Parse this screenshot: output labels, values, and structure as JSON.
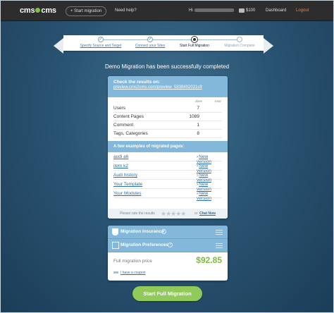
{
  "nav": {
    "logo_left": "cms",
    "logo_right": "cms",
    "start_migration": "+ Start migration",
    "need_help": "Need help?",
    "greeting": "Hi",
    "balance": "$100",
    "dashboard": "Dashboard",
    "logout": "Logout"
  },
  "steps": [
    {
      "label": "Specify Source and Target",
      "state": "done"
    },
    {
      "label": "Connect your Sites",
      "state": "done"
    },
    {
      "label": "Start Full Migration",
      "state": "current"
    },
    {
      "label": "Migration Complete",
      "state": "future"
    }
  ],
  "success_message": "Demo Migration has been successfully completed",
  "results": {
    "title": "Check the results on:",
    "url": "preview.cms2cms.com/preview_5838402021c9",
    "col_done": "done",
    "col_total": "total",
    "stats": [
      {
        "name": "Users",
        "done": "7"
      },
      {
        "name": "Content Pages",
        "done": "1089"
      },
      {
        "name": "Comment",
        "done": "1"
      },
      {
        "name": "Tags, Categories",
        "done": "8"
      }
    ],
    "examples_title": "A few examples of migrated pages:",
    "new_version_label": "New version",
    "examples": [
      "audi a6",
      "item k2",
      "Audi history",
      "Your Template",
      "Your Modules"
    ],
    "rate_label": "Please rate the results",
    "stars": "★★★★★",
    "or": "or",
    "chat_now": "Chat Now"
  },
  "options": {
    "insurance_label": "Migration Insurance",
    "preferences_label": "Migration Preferences",
    "help_glyph": "?",
    "price_label": "Full migration price",
    "price_value": "$92.85",
    "coupon": "I have a coupon"
  },
  "cta_label": "Start Full Migration",
  "icons": {
    "insurance": "shield-icon",
    "preferences": "preferences-icon",
    "menu": "hamburger-icon",
    "wallet": "wallet-icon"
  },
  "colors": {
    "accent_blue": "#84b8da",
    "price_green": "#7dbb3c",
    "cta_green": "#8fca5a",
    "logout_orange": "#e8833a"
  }
}
